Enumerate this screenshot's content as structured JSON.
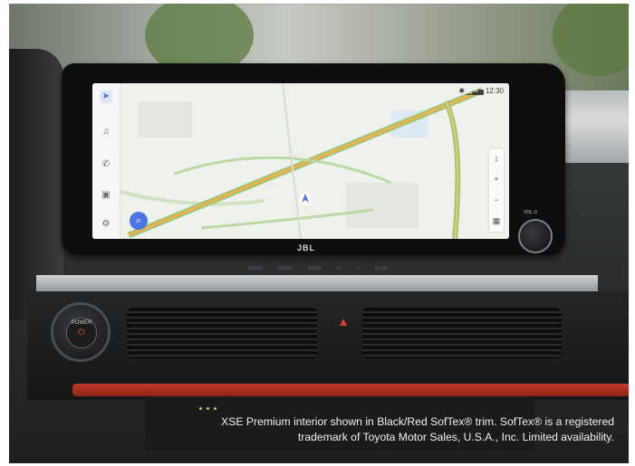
{
  "infotainment": {
    "time": "12:30",
    "brand": "JBL",
    "volume_label": "VOL ⏻",
    "power_label": "POWER",
    "hardkeys": [
      "AUDIO",
      "MENU",
      "HOME",
      "<",
      ">",
      "CLIM"
    ],
    "rail_icons": [
      "navigation-icon",
      "music-icon",
      "phone-icon",
      "car-icon",
      "gear-icon"
    ],
    "zoom": [
      "↕",
      "+",
      "−",
      "▦"
    ]
  },
  "caption": {
    "line1": "XSE Premium interior shown in Black/Red SofTex® trim. SofTex® is a registered",
    "line2": "trademark of Toyota Motor Sales, U.S.A., Inc. Limited availability."
  },
  "colors": {
    "accent_blue": "#4a76e8",
    "road_green": "#9bc77e",
    "road_orange": "#f0b04a",
    "trim_red": "#c23a2a"
  }
}
